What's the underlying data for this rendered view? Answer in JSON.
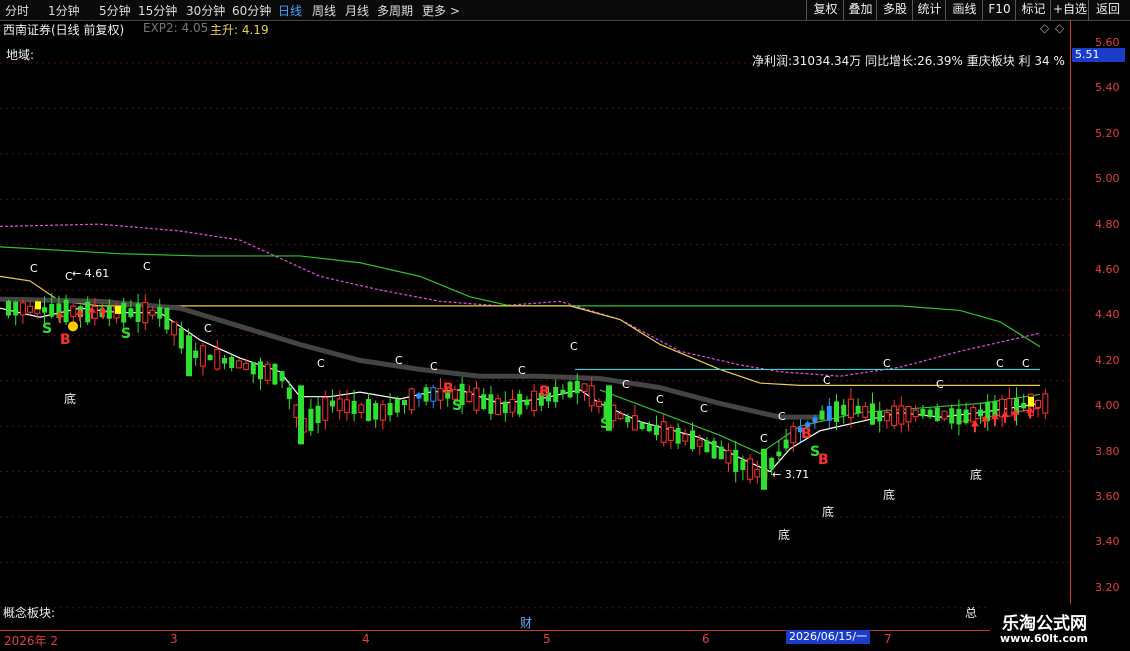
{
  "toolbar": {
    "periods": [
      "分时",
      "1分钟",
      "5分钟",
      "15分钟",
      "30分钟",
      "60分钟",
      "日线",
      "周线",
      "月线",
      "多周期",
      "更多 >"
    ],
    "active_period": "日线",
    "right_buttons": [
      "复权",
      "叠加",
      "多股",
      "统计",
      "画线",
      "F10",
      "标记",
      "+自选",
      "返回"
    ]
  },
  "info": {
    "stock_title": "西南证券(日线 前复权)",
    "exp2": "EXP2: 4.05",
    "zhusheng_label": "主升: 4.19",
    "region_label": "地域:",
    "financials": "净利润:31034.34万  同比增长:26.39%  重庆板块     利 34 %",
    "concept_label": "概念板块:",
    "cai_label": "财",
    "zong_label": "总"
  },
  "price_axis": {
    "ticks": [
      "5.60",
      "5.40",
      "5.20",
      "5.00",
      "4.80",
      "4.60",
      "4.40",
      "4.20",
      "4.00",
      "3.80",
      "3.60",
      "3.40",
      "3.20"
    ],
    "current_price": "5.51"
  },
  "date_axis": {
    "labels": [
      "2026年 2",
      "3",
      "4",
      "5",
      "6",
      "7"
    ],
    "cursor_date": "2026/06/15/一"
  },
  "annotations": {
    "high_label": "4.61",
    "low_label": "3.71",
    "di_labels": [
      "底",
      "底",
      "底",
      "底",
      "底"
    ],
    "markers": {
      "C": "C",
      "S": "S",
      "B": "B"
    }
  },
  "colors": {
    "up": "#ff3030",
    "down": "#30e030",
    "blue_candle": "#3090ff",
    "ma_magenta": "#e050e0",
    "ma_green": "#30c030",
    "ma_yellow": "#e8d050",
    "ma_gray": "#666666",
    "ma_white": "#ffffff",
    "ma_cyan": "#40d0d0"
  },
  "watermark": {
    "line1": "乐淘公式网",
    "line2": "www.60lt.com"
  }
}
